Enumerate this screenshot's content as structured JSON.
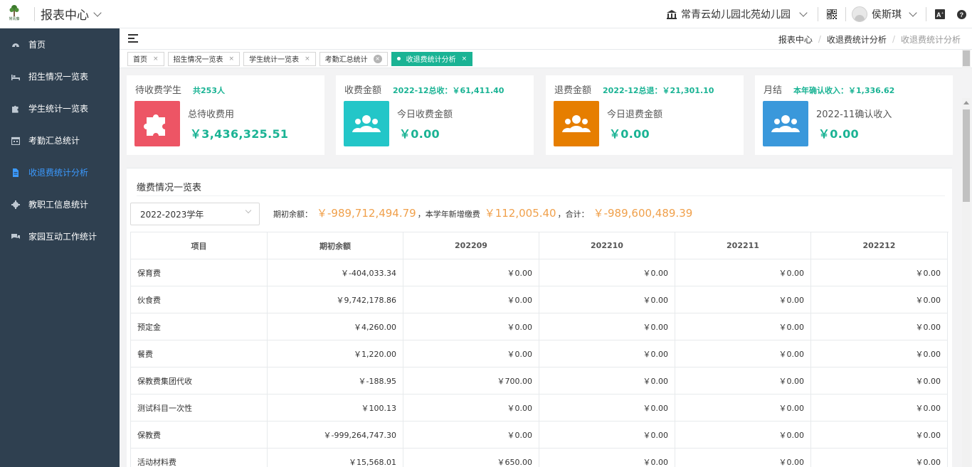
{
  "header": {
    "logo_text": "常青藤",
    "app_title": "报表中心",
    "school": "常青云幼儿园北苑幼儿园",
    "user": "侯斯琪"
  },
  "sidebar": {
    "items": [
      {
        "label": "首页",
        "icon": "dashboard-icon"
      },
      {
        "label": "招生情况一览表",
        "icon": "bed-icon"
      },
      {
        "label": "学生统计一览表",
        "icon": "puzzle-icon"
      },
      {
        "label": "考勤汇总统计",
        "icon": "calendar-icon"
      },
      {
        "label": "收退费统计分析",
        "icon": "file-icon"
      },
      {
        "label": "教职工信息统计",
        "icon": "gear-icon"
      },
      {
        "label": "家园互动工作统计",
        "icon": "chat-icon"
      }
    ],
    "active_index": 4
  },
  "breadcrumb": {
    "items": [
      "报表中心",
      "收退费统计分析",
      "收退费统计分析"
    ]
  },
  "tabs": [
    {
      "label": "首页",
      "close": "×"
    },
    {
      "label": "招生情况一览表",
      "close": "×"
    },
    {
      "label": "学生统计一览表",
      "close": "×"
    },
    {
      "label": "考勤汇总统计",
      "close": "×"
    },
    {
      "label": "收退费统计分析",
      "close": "×"
    }
  ],
  "cards": [
    {
      "title": "待收费学生",
      "note": "共253人",
      "label": "总待收费用",
      "value": "￥3,436,325.51",
      "color": "#ed5565",
      "icon": "puzzle-icon"
    },
    {
      "title": "收费金额",
      "note": "2022-12总收：￥61,411.40",
      "label": "今日收费金额",
      "value": "￥0.00",
      "color": "#23c6c8",
      "icon": "users-icon"
    },
    {
      "title": "退费金额",
      "note": "2022-12总退：￥21,301.10",
      "label": "今日退费金额",
      "value": "￥0.00",
      "color": "#e67e00",
      "icon": "users-icon"
    },
    {
      "title": "月结",
      "note": "本年确认收入：￥1,336.62",
      "label": "2022-11确认收入",
      "value": "￥0.00",
      "color": "#3a98db",
      "icon": "users-icon"
    }
  ],
  "panel": {
    "title": "缴费情况一览表",
    "year_select": "2022-2023学年",
    "summary": {
      "opening_label": "期初余额：",
      "opening_value": "￥-989,712,494.79",
      "new_label": "，本学年新增缴费",
      "new_value": "￥112,005.40",
      "total_label": "，合计：",
      "total_value": "￥-989,600,489.39"
    }
  },
  "table": {
    "columns": [
      "项目",
      "期初余额",
      "202209",
      "202210",
      "202211",
      "202212"
    ],
    "rows": [
      [
        "保育费",
        "￥-404,033.34",
        "￥0.00",
        "￥0.00",
        "￥0.00",
        "￥0.00"
      ],
      [
        "伙食费",
        "￥9,742,178.86",
        "￥0.00",
        "￥0.00",
        "￥0.00",
        "￥0.00"
      ],
      [
        "预定金",
        "￥4,260.00",
        "￥0.00",
        "￥0.00",
        "￥0.00",
        "￥0.00"
      ],
      [
        "餐费",
        "￥1,220.00",
        "￥0.00",
        "￥0.00",
        "￥0.00",
        "￥0.00"
      ],
      [
        "保教费集团代收",
        "￥-188.95",
        "￥700.00",
        "￥0.00",
        "￥0.00",
        "￥0.00"
      ],
      [
        "测试科目一次性",
        "￥100.13",
        "￥0.00",
        "￥0.00",
        "￥0.00",
        "￥0.00"
      ],
      [
        "保教费",
        "￥-999,264,747.30",
        "￥0.00",
        "￥0.00",
        "￥0.00",
        "￥0.00"
      ],
      [
        "活动材料费",
        "￥15,568.01",
        "￥650.00",
        "￥0.00",
        "￥0.00",
        "￥0.00"
      ]
    ]
  }
}
